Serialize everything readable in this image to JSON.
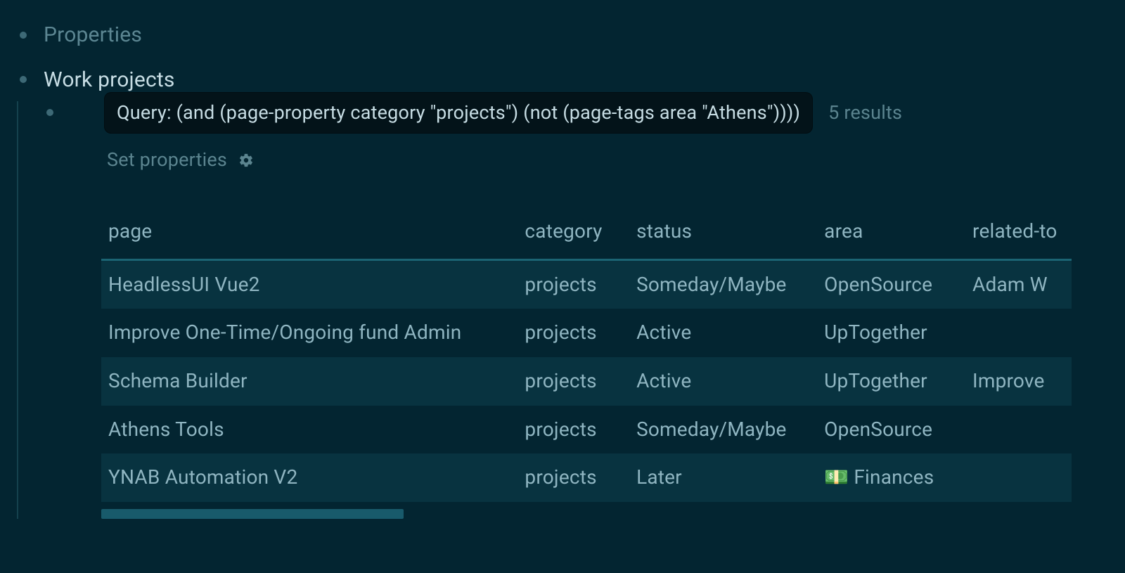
{
  "outline": {
    "properties_label": "Properties",
    "work_projects_label": "Work projects"
  },
  "query": {
    "text": "Query: (and (page-property category \"projects\") (not (page-tags area \"Athens\"))))",
    "results_label": "5 results",
    "set_properties_label": "Set properties"
  },
  "table": {
    "columns": {
      "page": "page",
      "category": "category",
      "status": "status",
      "area": "area",
      "related": "related-to"
    },
    "rows": [
      {
        "page": "HeadlessUI Vue2",
        "category": "projects",
        "status": "Someday/Maybe",
        "area": "OpenSource",
        "related": "Adam W"
      },
      {
        "page": "Improve One-Time/Ongoing fund Admin",
        "category": "projects",
        "status": "Active",
        "area": "UpTogether",
        "related": ""
      },
      {
        "page": "Schema Builder",
        "category": "projects",
        "status": "Active",
        "area": "UpTogether",
        "related": "Improve"
      },
      {
        "page": "Athens Tools",
        "category": "projects",
        "status": "Someday/Maybe",
        "area": "OpenSource",
        "related": ""
      },
      {
        "page": "YNAB Automation V2",
        "category": "projects",
        "status": "Later",
        "area": "💵 Finances",
        "related": ""
      }
    ]
  }
}
